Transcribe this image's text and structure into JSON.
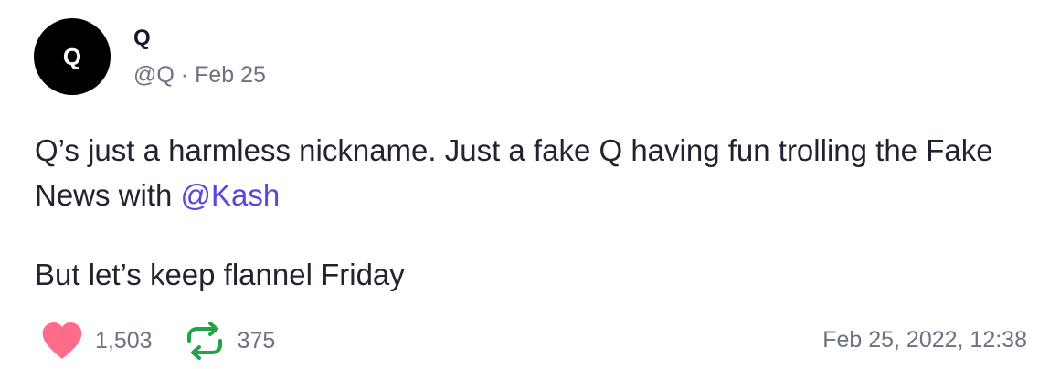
{
  "post": {
    "avatar_letter": "Q",
    "author_name": "Q",
    "handle": "@Q",
    "separator": "·",
    "date_short": "Feb 25",
    "body_line1_prefix": "Q’s just a harmless nickname. Just a fake Q having fun trolling the Fake News with ",
    "mention": "@Kash",
    "body_line2": "But let’s keep flannel Friday",
    "likes": "1,503",
    "reposts": "375",
    "timestamp": "Feb 25, 2022, 12:38"
  },
  "colors": {
    "like": "#ff6b8a",
    "repost": "#22a34a",
    "mention": "#5b44e0",
    "muted": "#6b7280"
  },
  "icons": {
    "like": "heart-icon",
    "repost": "repost-icon"
  }
}
